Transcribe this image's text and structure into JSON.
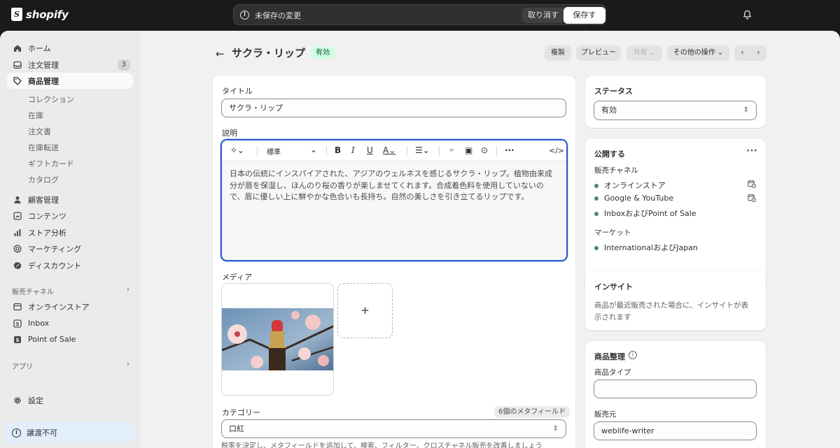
{
  "topbar": {
    "logo_text": "shopify",
    "unsaved_message": "未保存の変更",
    "discard_label": "取り消す",
    "save_label": "保存する"
  },
  "sidebar": {
    "items": [
      {
        "label": "ホーム",
        "icon": "home-icon"
      },
      {
        "label": "注文管理",
        "icon": "inbox-icon",
        "count": "3"
      },
      {
        "label": "商品管理",
        "icon": "tag-icon",
        "active": true
      }
    ],
    "product_sub": [
      "コレクション",
      "在庫",
      "注文書",
      "在庫転送",
      "ギフトカード",
      "カタログ"
    ],
    "items2": [
      {
        "label": "顧客管理",
        "icon": "person-icon"
      },
      {
        "label": "コンテンツ",
        "icon": "content-icon"
      },
      {
        "label": "ストア分析",
        "icon": "analytics-icon"
      },
      {
        "label": "マーケティング",
        "icon": "target-icon"
      },
      {
        "label": "ディスカウント",
        "icon": "discount-icon"
      }
    ],
    "sales_channels_label": "販売チャネル",
    "channels": [
      {
        "label": "オンラインストア",
        "icon": "store-icon"
      },
      {
        "label": "Inbox",
        "icon": "inbox-app-icon"
      },
      {
        "label": "Point of Sale",
        "icon": "pos-icon"
      }
    ],
    "apps_label": "アプリ",
    "settings_label": "設定",
    "transfer_label": "譲渡不可"
  },
  "header": {
    "title": "サクラ・リップ",
    "status_badge": "有効",
    "duplicate_label": "複製",
    "preview_label": "プレビュー",
    "share_label": "共有",
    "more_actions_label": "その他の操作"
  },
  "main": {
    "title_label": "タイトル",
    "title_value": "サクラ・リップ",
    "description_label": "説明",
    "format_value": "標準",
    "description_text": "日本の伝統にインスパイアされた、アジアのウェルネスを感じるサクラ・リップ。植物由来成分が唇を保湿し、ほんのり桜の香りが楽しませてくれます。合成着色料を使用していないので、唇に優しい上に鮮やかな色合いも長持ち。自然の美しさを引き立てるリップです。",
    "media_label": "メディア",
    "category_label": "カテゴリー",
    "metafields_badge": "6個のメタフィールド",
    "category_value": "口紅",
    "category_help": "税率を決定し、メタフィールドを追加して、検索、フィルター、クロスチャネル販売を改善しましょう"
  },
  "status_card": {
    "title": "ステータス",
    "value": "有効"
  },
  "publish_card": {
    "title": "公開する",
    "channels_label": "販売チャネル",
    "channels": [
      "オンラインストア",
      "Google & YouTube",
      "InboxおよびPoint of Sale"
    ],
    "markets_label": "マーケット",
    "markets": [
      "InternationalおよびJapan"
    ]
  },
  "insights_card": {
    "title": "インサイト",
    "text_line1": "商品が最近販売された場合に、インサイトが表",
    "text_line2": "示されます"
  },
  "organization_card": {
    "title": "商品整理",
    "type_label": "商品タイプ",
    "type_value": "",
    "vendor_label": "販売元",
    "vendor_value": "weblife-writer"
  },
  "colors": {
    "accent": "#2c58c9",
    "status_bg": "#cdfee1",
    "status_text": "#0c5132",
    "channel_dot": "#4b8a6b"
  }
}
